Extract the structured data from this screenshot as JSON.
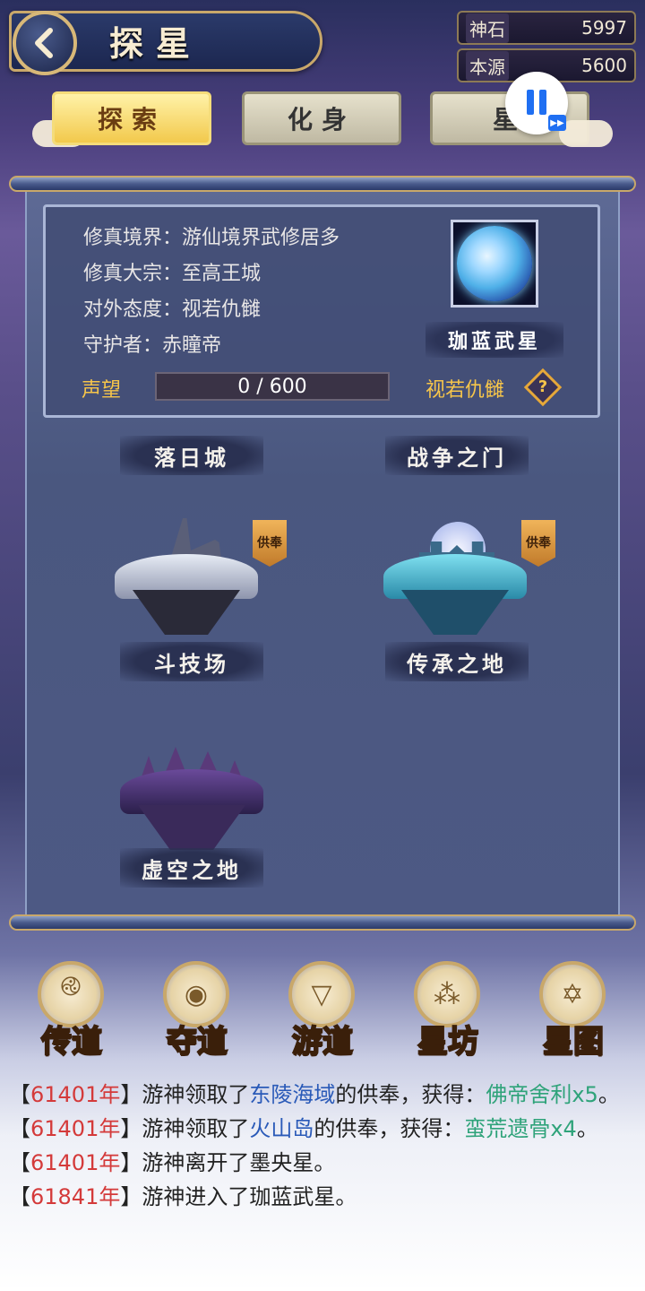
{
  "header": {
    "title": "探星",
    "resources": [
      {
        "label": "神石",
        "value": "5997"
      },
      {
        "label": "本源",
        "value": "5600"
      }
    ]
  },
  "tabs": [
    {
      "label": "探索",
      "active": true
    },
    {
      "label": "化身",
      "active": false
    },
    {
      "label": "星",
      "active": false
    }
  ],
  "star_info": {
    "lines": [
      "修真境界：游仙境界武修居多",
      "修真大宗：至高王城",
      "对外态度：视若仇雠",
      "守护者：赤瞳帝"
    ],
    "planet_name": "珈蓝武星",
    "reputation_label": "声望",
    "reputation_value": "0 / 600",
    "reputation_status": "视若仇雠",
    "help_icon": "?"
  },
  "locations": [
    {
      "name": "落日城"
    },
    {
      "name": "战争之门"
    },
    {
      "name": "斗技场",
      "tribute": "供奉"
    },
    {
      "name": "传承之地",
      "tribute": "供奉"
    },
    {
      "name": "虚空之地"
    }
  ],
  "bottom_nav": [
    {
      "label": "传道",
      "icon": "triskelion-icon"
    },
    {
      "label": "夺道",
      "icon": "planet-orbit-icon"
    },
    {
      "label": "游道",
      "icon": "triangle-orbit-icon"
    },
    {
      "label": "星坊",
      "icon": "constellation-icon"
    },
    {
      "label": "星图",
      "icon": "hexagram-icon"
    }
  ],
  "log": [
    {
      "year": "61401年",
      "pre": "游神领取了",
      "place": "东陵海域",
      "mid": "的供奉，获得：",
      "item": "佛帝舍利x5",
      "post": "。"
    },
    {
      "year": "61401年",
      "pre": "游神领取了",
      "place": "火山岛",
      "mid": "的供奉，获得：",
      "item": "蛮荒遗骨x4",
      "post": "。"
    },
    {
      "year": "61401年",
      "pre": "游神离开了墨央星。",
      "place": "",
      "mid": "",
      "item": "",
      "post": ""
    },
    {
      "year": "61841年",
      "pre": "游神进入了珈蓝武星。",
      "place": "",
      "mid": "",
      "item": "",
      "post": ""
    }
  ],
  "colors": {
    "accent_gold": "#f6c54a",
    "log_year": "#d43a3a",
    "log_place": "#2a5ab8",
    "log_item": "#2fa37a"
  }
}
